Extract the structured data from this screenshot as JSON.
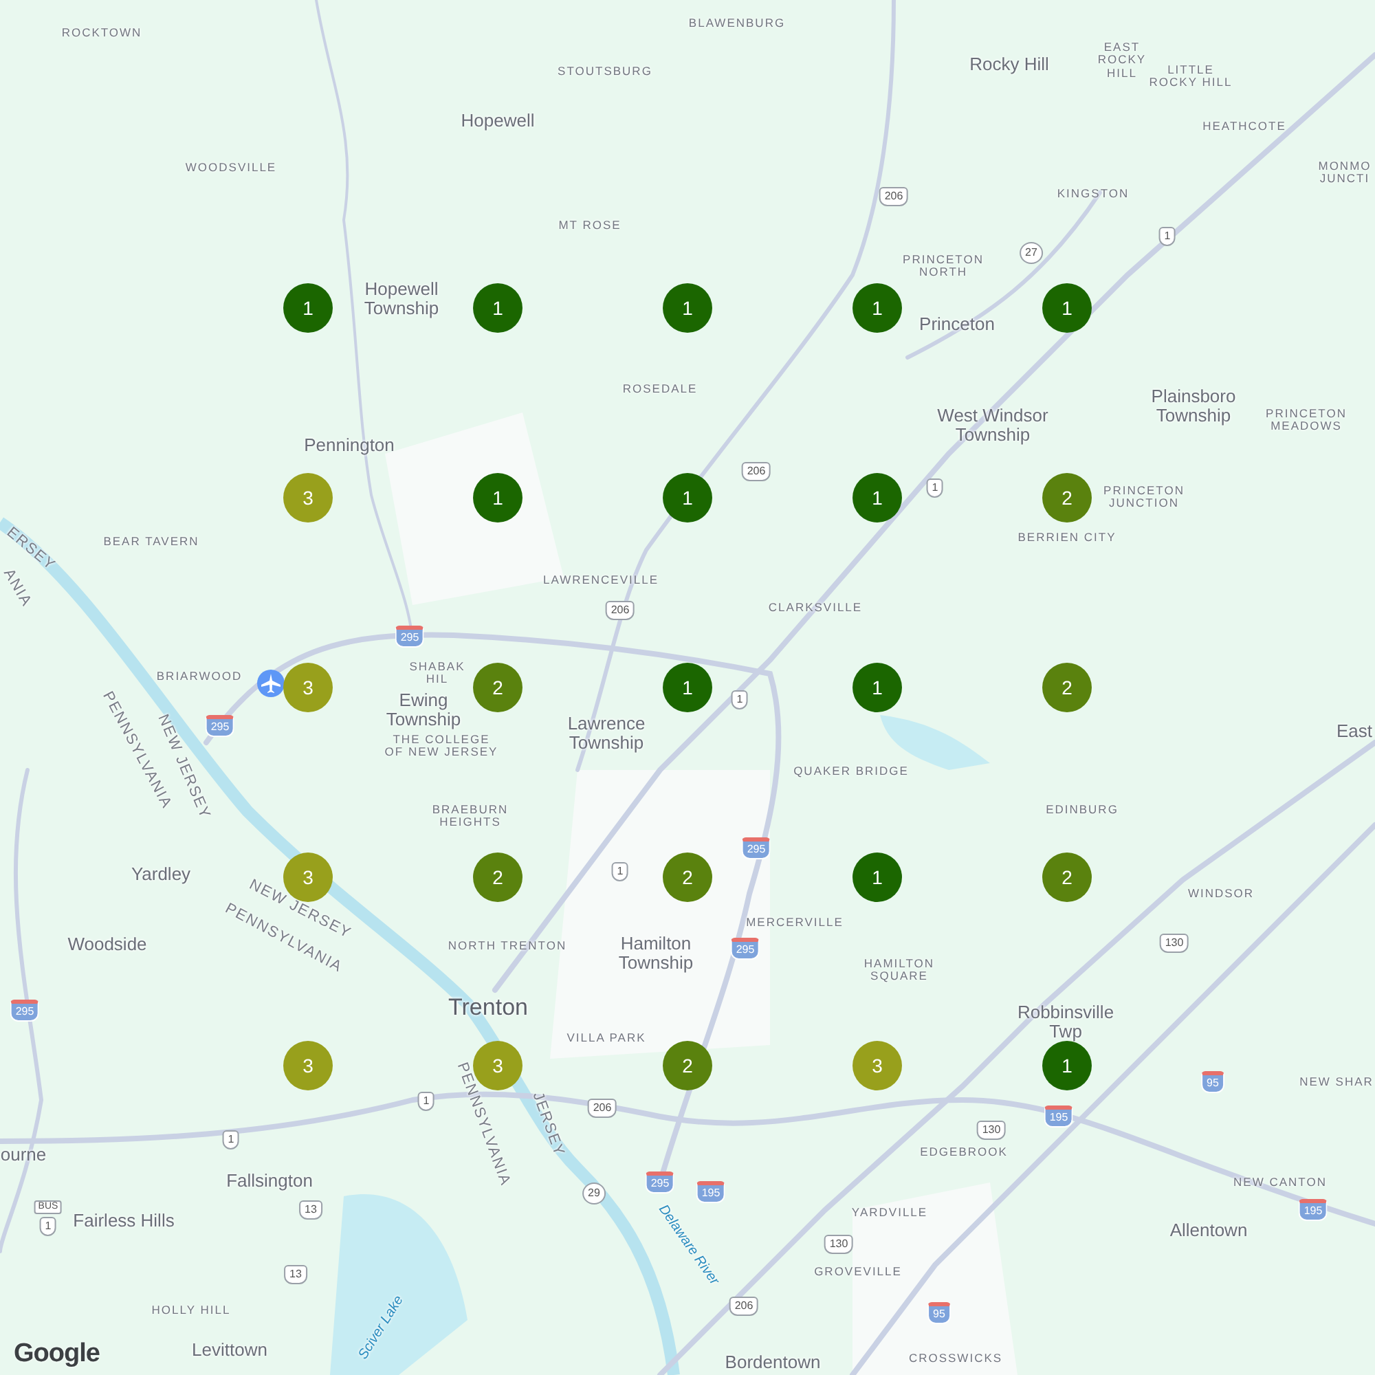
{
  "places": [
    {
      "name": "ROCKTOWN",
      "kind": "locality"
    },
    {
      "name": "BLAWENBURG",
      "kind": "locality"
    },
    {
      "name": "STOUTSBURG",
      "kind": "locality"
    },
    {
      "name": "Hopewell",
      "kind": "town"
    },
    {
      "name": "Rocky Hill",
      "kind": "town"
    },
    {
      "name": "EAST ROCKY HILL",
      "kind": "locality"
    },
    {
      "name": "LITTLE ROCKY HILL",
      "kind": "locality"
    },
    {
      "name": "HEATHCOTE",
      "kind": "locality"
    },
    {
      "name": "WOODSVILLE",
      "kind": "locality"
    },
    {
      "name": "MONMO JUNCTI",
      "kind": "locality"
    },
    {
      "name": "KINGSTON",
      "kind": "locality"
    },
    {
      "name": "MT ROSE",
      "kind": "locality"
    },
    {
      "name": "PRINCETON NORTH",
      "kind": "locality"
    },
    {
      "name": "Hopewell Township",
      "kind": "town"
    },
    {
      "name": "Princeton",
      "kind": "town"
    },
    {
      "name": "ROSEDALE",
      "kind": "locality"
    },
    {
      "name": "West Windsor Township",
      "kind": "town"
    },
    {
      "name": "Plainsboro Township",
      "kind": "town"
    },
    {
      "name": "PRINCETON MEADOWS",
      "kind": "locality"
    },
    {
      "name": "Pennington",
      "kind": "town"
    },
    {
      "name": "PRINCETON JUNCTION",
      "kind": "locality"
    },
    {
      "name": "BERRIEN CITY",
      "kind": "locality"
    },
    {
      "name": "BEAR TAVERN",
      "kind": "locality"
    },
    {
      "name": "LAWRENCEVILLE",
      "kind": "locality"
    },
    {
      "name": "CLARKSVILLE",
      "kind": "locality"
    },
    {
      "name": "BRIARWOOD",
      "kind": "locality"
    },
    {
      "name": "SHABAK HIL",
      "kind": "locality"
    },
    {
      "name": "Ewing Township",
      "kind": "town"
    },
    {
      "name": "THE COLLEGE OF NEW JERSEY",
      "kind": "locality"
    },
    {
      "name": "Lawrence Township",
      "kind": "town"
    },
    {
      "name": "QUAKER BRIDGE",
      "kind": "locality"
    },
    {
      "name": "East",
      "kind": "town"
    },
    {
      "name": "EDINBURG",
      "kind": "locality"
    },
    {
      "name": "BRAEBURN HEIGHTS",
      "kind": "locality"
    },
    {
      "name": "Yardley",
      "kind": "town"
    },
    {
      "name": "WINDSOR",
      "kind": "locality"
    },
    {
      "name": "MERCERVILLE",
      "kind": "locality"
    },
    {
      "name": "Woodside",
      "kind": "town"
    },
    {
      "name": "NORTH TRENTON",
      "kind": "locality"
    },
    {
      "name": "Hamilton Township",
      "kind": "town"
    },
    {
      "name": "HAMILTON SQUARE",
      "kind": "locality"
    },
    {
      "name": "Trenton",
      "kind": "city"
    },
    {
      "name": "VILLA PARK",
      "kind": "locality"
    },
    {
      "name": "Robbinsville Twp",
      "kind": "town"
    },
    {
      "name": "NEW SHAR",
      "kind": "locality"
    },
    {
      "name": "ourne",
      "kind": "town"
    },
    {
      "name": "EDGEBROOK",
      "kind": "locality"
    },
    {
      "name": "Fallsington",
      "kind": "town"
    },
    {
      "name": "NEW CANTON",
      "kind": "locality"
    },
    {
      "name": "Fairless Hills",
      "kind": "town"
    },
    {
      "name": "YARDVILLE",
      "kind": "locality"
    },
    {
      "name": "Allentown",
      "kind": "town"
    },
    {
      "name": "GROVEVILLE",
      "kind": "locality"
    },
    {
      "name": "HOLLY HILL",
      "kind": "locality"
    },
    {
      "name": "Levittown",
      "kind": "town"
    },
    {
      "name": "Bordentown",
      "kind": "town"
    },
    {
      "name": "CROSSWICKS",
      "kind": "locality"
    },
    {
      "name": "ERSEY",
      "kind": "state"
    },
    {
      "name": "ANIA",
      "kind": "state"
    },
    {
      "name": "NEW JERSEY",
      "kind": "state"
    },
    {
      "name": "PENNSYLVANIA",
      "kind": "state"
    },
    {
      "name": "NEW JERSEY",
      "kind": "state"
    },
    {
      "name": "PENNSYLVANIA",
      "kind": "state"
    },
    {
      "name": "PENNSYLVANIA",
      "kind": "state"
    },
    {
      "name": "JERSEY",
      "kind": "state"
    },
    {
      "name": "Delaware River",
      "kind": "water"
    },
    {
      "name": "Sciver Lake",
      "kind": "water"
    }
  ],
  "shields": [
    {
      "label": "206",
      "kind": "us"
    },
    {
      "label": "206",
      "kind": "us"
    },
    {
      "label": "206",
      "kind": "us"
    },
    {
      "label": "206",
      "kind": "us"
    },
    {
      "label": "206",
      "kind": "us"
    },
    {
      "label": "27",
      "kind": "state"
    },
    {
      "label": "1",
      "kind": "us"
    },
    {
      "label": "1",
      "kind": "us"
    },
    {
      "label": "1",
      "kind": "us"
    },
    {
      "label": "1",
      "kind": "us"
    },
    {
      "label": "1",
      "kind": "us"
    },
    {
      "label": "1",
      "kind": "us"
    },
    {
      "label": "1",
      "kind": "us"
    },
    {
      "label": "BUS",
      "kind": "bus"
    },
    {
      "label": "295",
      "kind": "interstate"
    },
    {
      "label": "295",
      "kind": "interstate"
    },
    {
      "label": "295",
      "kind": "interstate"
    },
    {
      "label": "295",
      "kind": "interstate"
    },
    {
      "label": "295",
      "kind": "interstate"
    },
    {
      "label": "295",
      "kind": "interstate"
    },
    {
      "label": "195",
      "kind": "interstate"
    },
    {
      "label": "195",
      "kind": "interstate"
    },
    {
      "label": "195",
      "kind": "interstate"
    },
    {
      "label": "95",
      "kind": "interstate"
    },
    {
      "label": "95",
      "kind": "interstate"
    },
    {
      "label": "29",
      "kind": "state"
    },
    {
      "label": "13",
      "kind": "us"
    },
    {
      "label": "13",
      "kind": "us"
    },
    {
      "label": "130",
      "kind": "us"
    },
    {
      "label": "130",
      "kind": "us"
    },
    {
      "label": "130",
      "kind": "us"
    }
  ],
  "markers": [
    {
      "count": "1",
      "color": "#1b6600"
    },
    {
      "count": "1",
      "color": "#1b6600"
    },
    {
      "count": "1",
      "color": "#1b6600"
    },
    {
      "count": "1",
      "color": "#1b6600"
    },
    {
      "count": "1",
      "color": "#1b6600"
    },
    {
      "count": "3",
      "color": "#98a01c"
    },
    {
      "count": "1",
      "color": "#1b6600"
    },
    {
      "count": "1",
      "color": "#1b6600"
    },
    {
      "count": "1",
      "color": "#1b6600"
    },
    {
      "count": "2",
      "color": "#5a820e"
    },
    {
      "count": "3",
      "color": "#98a01c"
    },
    {
      "count": "2",
      "color": "#5a820e"
    },
    {
      "count": "1",
      "color": "#1b6600"
    },
    {
      "count": "1",
      "color": "#1b6600"
    },
    {
      "count": "2",
      "color": "#5a820e"
    },
    {
      "count": "3",
      "color": "#98a01c"
    },
    {
      "count": "2",
      "color": "#5a820e"
    },
    {
      "count": "2",
      "color": "#5a820e"
    },
    {
      "count": "1",
      "color": "#1b6600"
    },
    {
      "count": "2",
      "color": "#5a820e"
    },
    {
      "count": "3",
      "color": "#98a01c"
    },
    {
      "count": "3",
      "color": "#98a01c"
    },
    {
      "count": "2",
      "color": "#5a820e"
    },
    {
      "count": "3",
      "color": "#98a01c"
    },
    {
      "count": "1",
      "color": "#1b6600"
    }
  ],
  "logo": "Google"
}
